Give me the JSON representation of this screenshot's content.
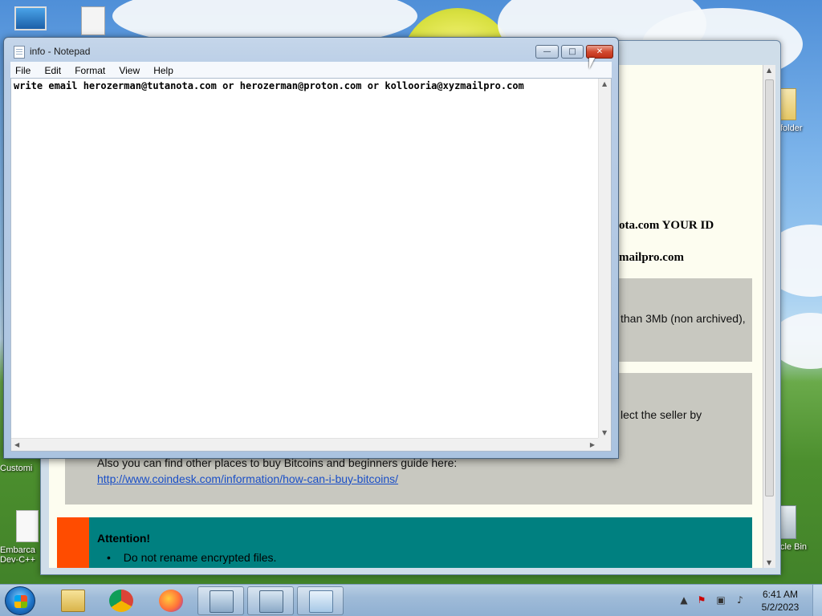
{
  "desktop": {
    "icons": [
      {
        "label": ""
      },
      {
        "label": ""
      },
      {
        "label": "Customi"
      },
      {
        "label": "Embarca\nDev-C++"
      },
      {
        "label": "folder"
      },
      {
        "label": "cle Bin"
      }
    ]
  },
  "ransom_window": {
    "lines": [
      "ota.com   YOUR ID",
      "mailpro.com"
    ],
    "gray_box_1_text": "than 3Mb (non archived),",
    "gray_box_2_text": "lect the seller by",
    "buy_text": "Also you can find other places to buy Bitcoins and beginners guide here:",
    "buy_link": "http://www.coindesk.com/information/how-can-i-buy-bitcoins/",
    "attention_title": "Attention!",
    "attention_items": [
      "Do not rename encrypted files."
    ],
    "colors": {
      "teal": "#008080",
      "orange": "#ff4c00",
      "gray_box": "#c8c8c0",
      "paper": "#fdfdf0"
    }
  },
  "notepad": {
    "title": "info - Notepad",
    "menu": [
      "File",
      "Edit",
      "Format",
      "View",
      "Help"
    ],
    "content": "write email herozerman@tutanota.com or herozerman@proton.com or kollooria@xyzmailpro.com",
    "caption": {
      "minimize": "—",
      "maximize": "□",
      "close": "✕"
    }
  },
  "taskbar": {
    "items": [
      {
        "name": "file-explorer-icon",
        "active": false
      },
      {
        "name": "chrome-icon",
        "active": false
      },
      {
        "name": "firefox-icon",
        "active": false
      },
      {
        "name": "installer-icon",
        "active": true
      },
      {
        "name": "installer-icon",
        "active": true
      },
      {
        "name": "notepad-icon",
        "active": true
      }
    ],
    "clock_time": "6:41 AM",
    "clock_date": "5/2/2023"
  }
}
